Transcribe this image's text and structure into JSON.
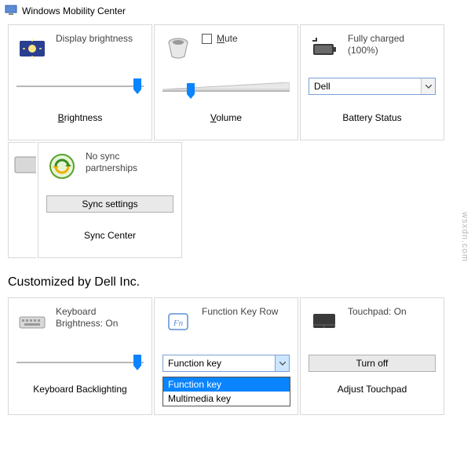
{
  "window": {
    "title": "Windows Mobility Center"
  },
  "tiles": {
    "brightness": {
      "label": "Display brightness",
      "footer_pre": "B",
      "footer_post": "rightness",
      "slider_pct": 95
    },
    "volume": {
      "mute_label": "M",
      "mute_label_post": "ute",
      "footer_pre": "V",
      "footer_post": "olume",
      "slider_pct": 22
    },
    "battery": {
      "label": "Fully charged (100%)",
      "combo_value": "Dell",
      "footer": "Battery Status"
    },
    "sync": {
      "label": "No sync partnerships",
      "button": "Sync settings",
      "footer": "Sync Center"
    }
  },
  "customized": {
    "header": "Customized by Dell Inc.",
    "keyboard": {
      "label": "Keyboard Brightness: On",
      "footer": "Keyboard Backlighting",
      "slider_pct": 95
    },
    "fnrow": {
      "label": "Function Key Row",
      "combo_value": "Function key",
      "options": [
        "Function key",
        "Multimedia key"
      ],
      "selected_index": 0
    },
    "touchpad": {
      "label": "Touchpad: On",
      "button": "Turn off",
      "footer": "Adjust Touchpad"
    }
  },
  "watermark": "wsxdn.com"
}
